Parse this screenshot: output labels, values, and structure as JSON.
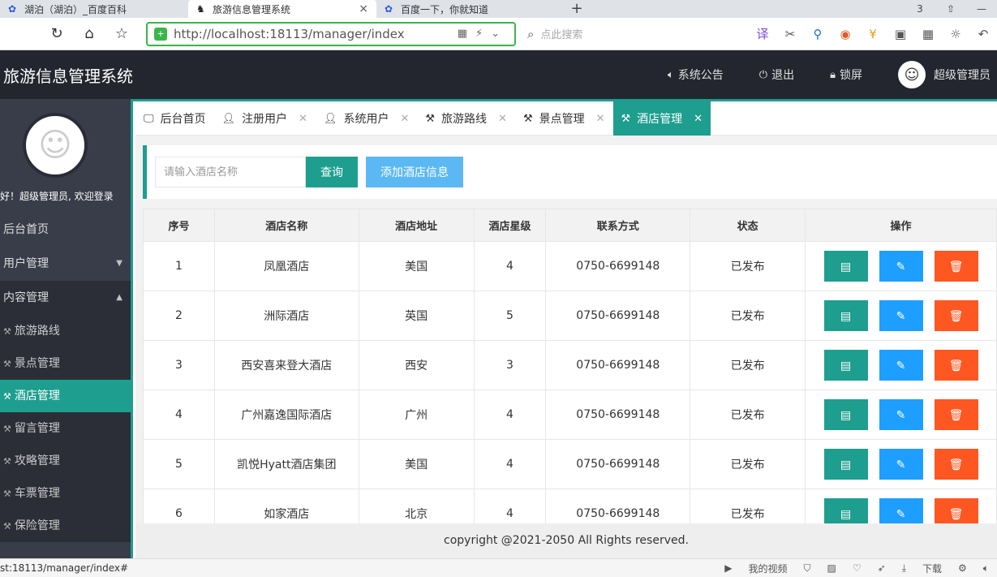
{
  "browser": {
    "tabs": [
      {
        "title": "湖泊（湖泊）_百度百科",
        "active": false
      },
      {
        "title": "旅游信息管理系统",
        "active": true
      },
      {
        "title": "百度一下，你就知道",
        "active": false
      }
    ],
    "tab_count": "3",
    "url": "http://localhost:18113/manager/index",
    "search_placeholder": "点此搜索",
    "status_url": "st:18113/manager/index#",
    "status_items": [
      "我的视频",
      "下载"
    ]
  },
  "header": {
    "title": "旅游信息管理系统",
    "announce": "系统公告",
    "logout": "退出",
    "lock": "锁屏",
    "user": "超级管理员"
  },
  "sidebar": {
    "welcome": "好！超级管理员, 欢迎登录",
    "home": "后台首页",
    "user_mgmt": "用户管理",
    "content_mgmt": "内容管理",
    "sub_items": [
      "旅游路线",
      "景点管理",
      "酒店管理",
      "留言管理",
      "攻略管理",
      "车票管理",
      "保险管理"
    ],
    "active_index": 2
  },
  "content_tabs": [
    {
      "label": "后台首页",
      "icon": "monitor-icon",
      "closable": false
    },
    {
      "label": "注册用户",
      "icon": "user-icon",
      "closable": true
    },
    {
      "label": "系统用户",
      "icon": "user-icon",
      "closable": true
    },
    {
      "label": "旅游路线",
      "icon": "tools-icon",
      "closable": true
    },
    {
      "label": "景点管理",
      "icon": "tools-icon",
      "closable": true
    },
    {
      "label": "酒店管理",
      "icon": "tools-icon",
      "closable": true,
      "active": true
    }
  ],
  "toolbar": {
    "search_placeholder": "请输入酒店名称",
    "query_label": "查询",
    "add_label": "添加酒店信息"
  },
  "table": {
    "columns": [
      "序号",
      "酒店名称",
      "酒店地址",
      "酒店星级",
      "联系方式",
      "状态",
      "操作"
    ],
    "rows": [
      [
        "1",
        "凤凰酒店",
        "美国",
        "4",
        "0750-6699148",
        "已发布"
      ],
      [
        "2",
        "洲际酒店",
        "英国",
        "5",
        "0750-6699148",
        "已发布"
      ],
      [
        "3",
        "西安喜来登大酒店",
        "西安",
        "3",
        "0750-6699148",
        "已发布"
      ],
      [
        "4",
        "广州嘉逸国际酒店",
        "广州",
        "4",
        "0750-6699148",
        "已发布"
      ],
      [
        "5",
        "凯悦Hyatt酒店集团",
        "美国",
        "4",
        "0750-6699148",
        "已发布"
      ],
      [
        "6",
        "如家酒店",
        "北京",
        "4",
        "0750-6699148",
        "已发布"
      ]
    ]
  },
  "footer": {
    "copyright": "copyright @2021-2050 All Rights reserved."
  },
  "colors": {
    "accent": "#1e9e8f",
    "sidebar_bg": "#393d49",
    "header_bg": "#23262e",
    "edit_btn": "#1e9fff",
    "delete_btn": "#ff5722",
    "add_btn": "#5cb8f2"
  }
}
